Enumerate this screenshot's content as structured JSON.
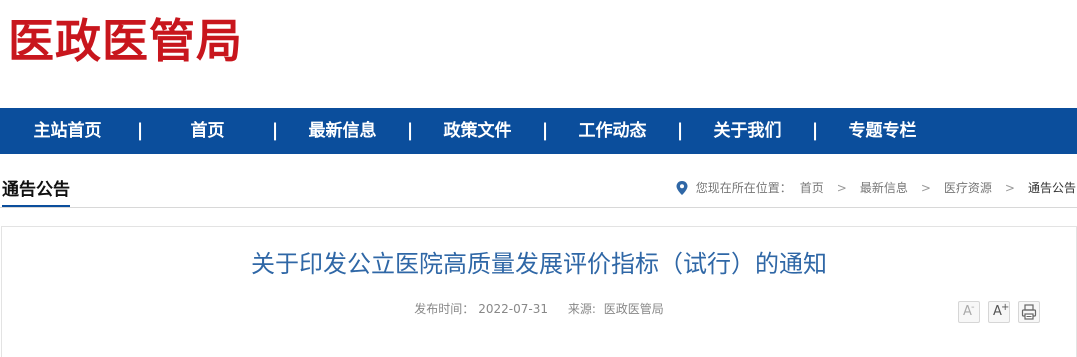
{
  "header": {
    "logo_text": "医政医管局"
  },
  "nav": {
    "items": [
      {
        "label": "主站首页"
      },
      {
        "label": "首页"
      },
      {
        "label": "最新信息"
      },
      {
        "label": "政策文件"
      },
      {
        "label": "工作动态"
      },
      {
        "label": "关于我们"
      },
      {
        "label": "专题专栏"
      }
    ],
    "separator": "|"
  },
  "section": {
    "title": "通告公告",
    "location_label": "您现在所在位置：",
    "breadcrumb": [
      {
        "label": "首页"
      },
      {
        "label": "最新信息"
      },
      {
        "label": "医疗资源"
      },
      {
        "label": "通告公告"
      }
    ],
    "breadcrumb_sep": ">"
  },
  "article": {
    "title": "关于印发公立医院高质量发展评价指标（试行）的通知",
    "publish_label": "发布时间：",
    "publish_date": "2022-07-31",
    "source_label": "来源:",
    "source": "医政医管局",
    "tools": {
      "font_smaller": {
        "glyph": "A",
        "mark": "-"
      },
      "font_larger": {
        "glyph": "A",
        "mark": "+"
      }
    }
  },
  "colors": {
    "brand_red": "#c8161d",
    "nav_blue": "#0b4e9c",
    "title_blue": "#2f67a6"
  },
  "icons": [
    "location-pin-icon",
    "print-icon"
  ]
}
